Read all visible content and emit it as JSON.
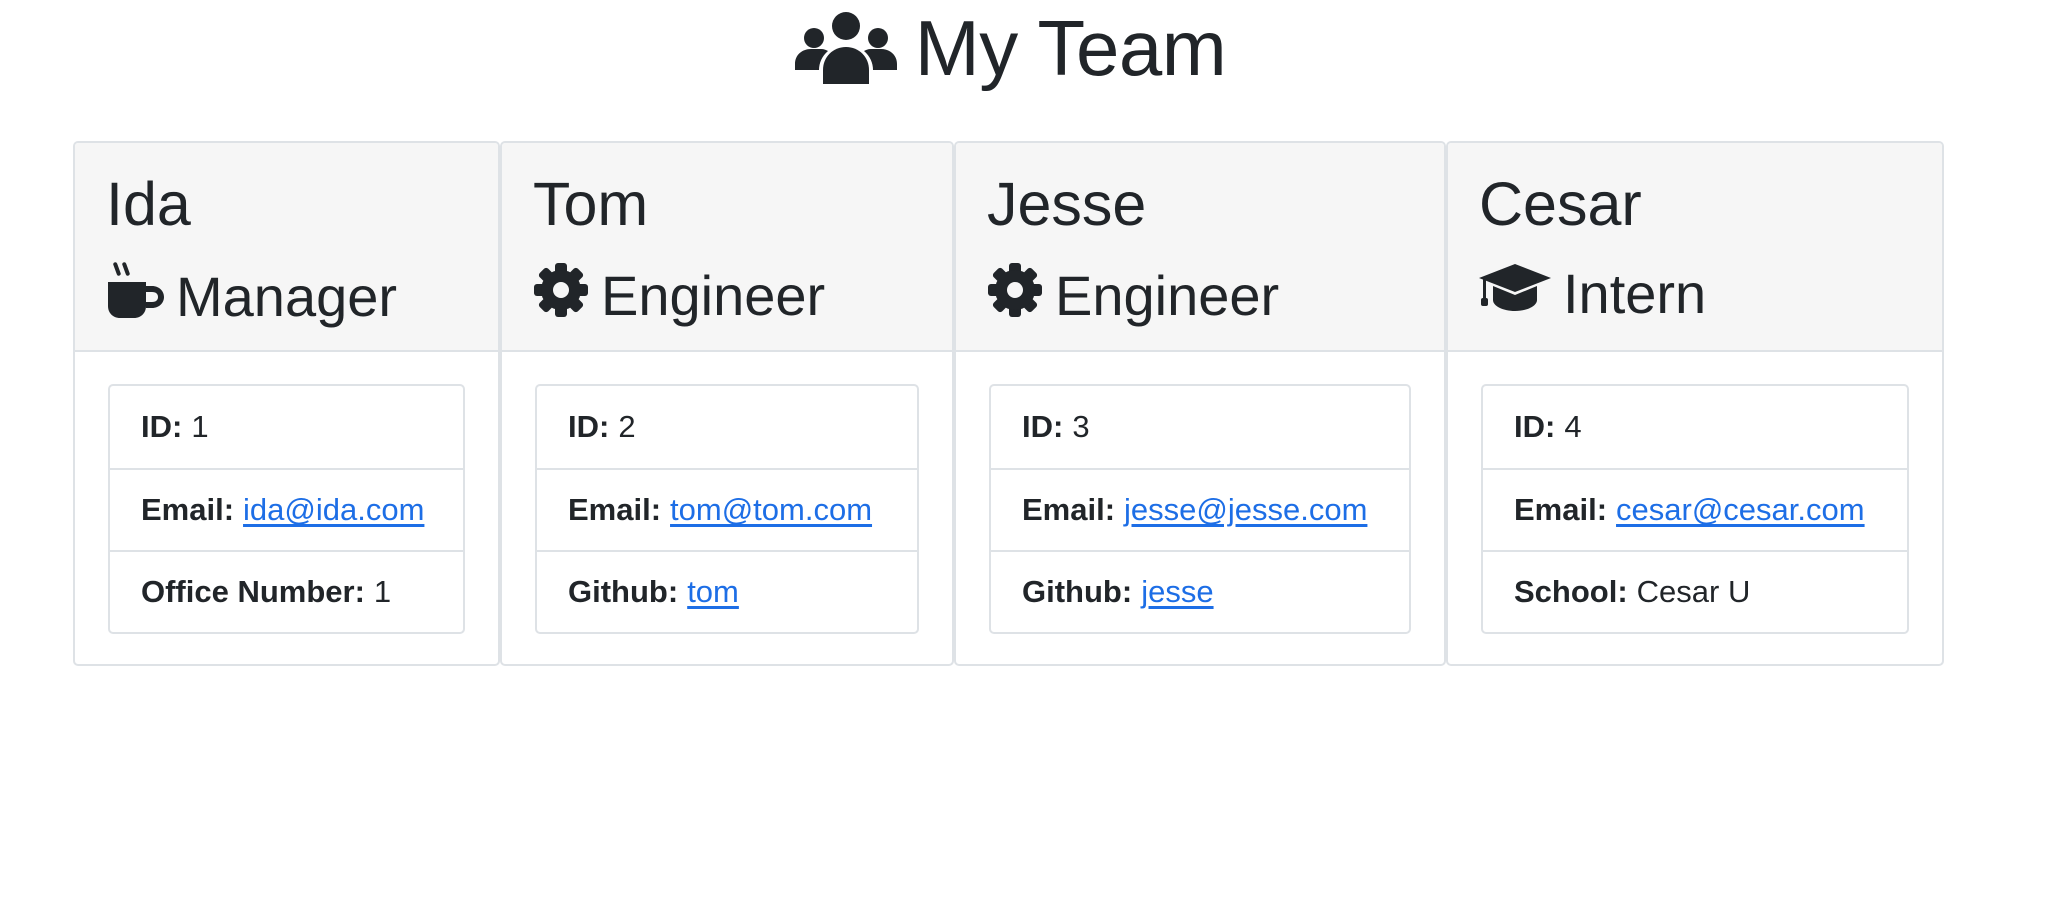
{
  "header": {
    "title": "My Team",
    "icon": "users-icon"
  },
  "cards": [
    {
      "name": "Ida",
      "role": "Manager",
      "role_icon": "coffee-mug-icon",
      "items": [
        {
          "label": "ID:",
          "value": "1",
          "link": false
        },
        {
          "label": "Email:",
          "value": "ida@ida.com",
          "link": true
        },
        {
          "label": "Office Number:",
          "value": "1",
          "link": false
        }
      ]
    },
    {
      "name": "Tom",
      "role": "Engineer",
      "role_icon": "gear-icon",
      "items": [
        {
          "label": "ID:",
          "value": "2",
          "link": false
        },
        {
          "label": "Email:",
          "value": "tom@tom.com",
          "link": true
        },
        {
          "label": "Github:",
          "value": "tom",
          "link": true
        }
      ]
    },
    {
      "name": "Jesse",
      "role": "Engineer",
      "role_icon": "gear-icon",
      "items": [
        {
          "label": "ID:",
          "value": "3",
          "link": false
        },
        {
          "label": "Email:",
          "value": "jesse@jesse.com",
          "link": true
        },
        {
          "label": "Github:",
          "value": "jesse",
          "link": true
        }
      ]
    },
    {
      "name": "Cesar",
      "role": "Intern",
      "role_icon": "graduation-cap-icon",
      "items": [
        {
          "label": "ID:",
          "value": "4",
          "link": false
        },
        {
          "label": "Email:",
          "value": "cesar@cesar.com",
          "link": true
        },
        {
          "label": "School:",
          "value": "Cesar U",
          "link": false
        }
      ]
    }
  ],
  "colors": {
    "text": "#212529",
    "link": "#1d6ee6",
    "header_bg": "#f6f6f6",
    "border": "#dee2e6"
  }
}
